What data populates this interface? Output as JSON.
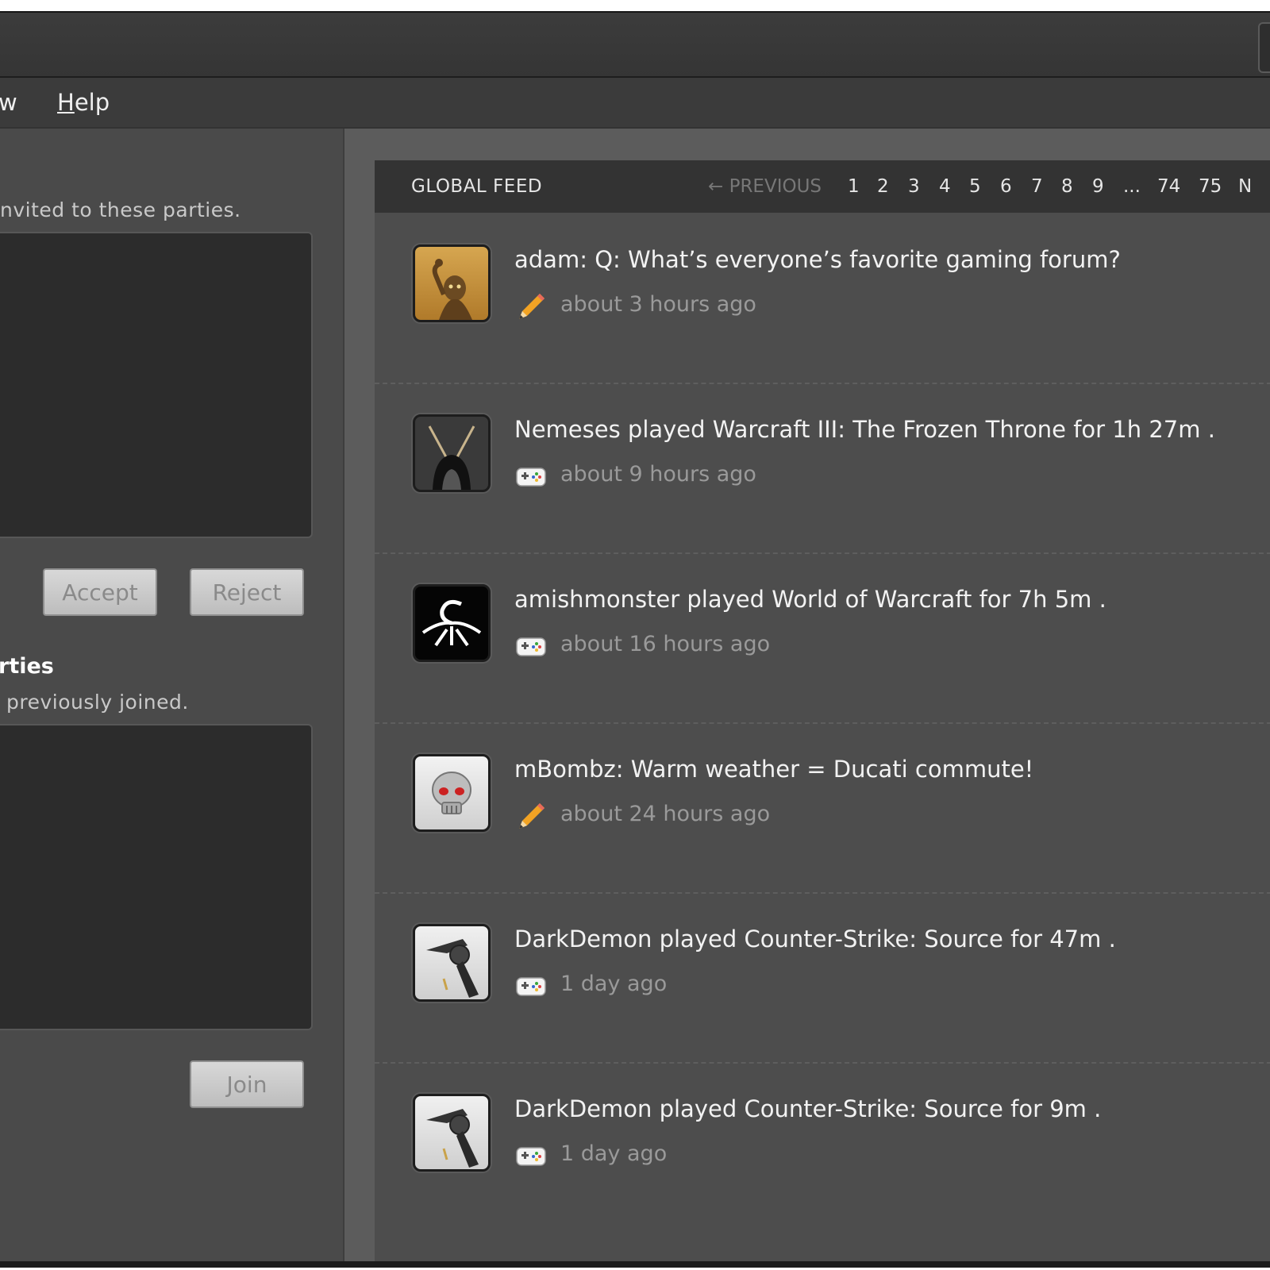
{
  "menu": {
    "view_partial": "w",
    "help": "Help"
  },
  "left": {
    "invites_hint": "nvited to these parties.",
    "accept_label": "Accept",
    "reject_label": "Reject",
    "parties_title": "rties",
    "parties_hint": "previously joined.",
    "join_label": "Join"
  },
  "feed": {
    "title": "GLOBAL FEED",
    "previous": "← PREVIOUS",
    "pages": [
      "1",
      "2",
      "3",
      "4",
      "5",
      "6",
      "7",
      "8",
      "9",
      "...",
      "74",
      "75",
      "N"
    ],
    "items": [
      {
        "text": "adam: Q: What’s everyone’s favorite gaming forum?",
        "time": "about 3 hours ago",
        "icon": "pencil-icon",
        "avatar": "gollum-avatar"
      },
      {
        "text": "Nemeses played Warcraft III: The Frozen Throne for 1h 27m .",
        "time": "about 9 hours ago",
        "icon": "gamepad-icon",
        "avatar": "dark-creature-avatar"
      },
      {
        "text": "amishmonster played World of Warcraft for 7h 5m .",
        "time": "about 16 hours ago",
        "icon": "gamepad-icon",
        "avatar": "emblem-avatar"
      },
      {
        "text": "mBombz: Warm weather = Ducati commute!",
        "time": "about 24 hours ago",
        "icon": "pencil-icon",
        "avatar": "skull-avatar"
      },
      {
        "text": "DarkDemon played Counter-Strike: Source for 47m .",
        "time": "1 day ago",
        "icon": "gamepad-icon",
        "avatar": "revolver-avatar"
      },
      {
        "text": "DarkDemon played Counter-Strike: Source for 9m .",
        "time": "1 day ago",
        "icon": "gamepad-icon",
        "avatar": "revolver-avatar"
      }
    ]
  },
  "colors": {
    "accent_text": "#f2f2f2",
    "muted_text": "#9a9a9a",
    "panel": "#4a4a4a",
    "feed_header": "#333333"
  }
}
